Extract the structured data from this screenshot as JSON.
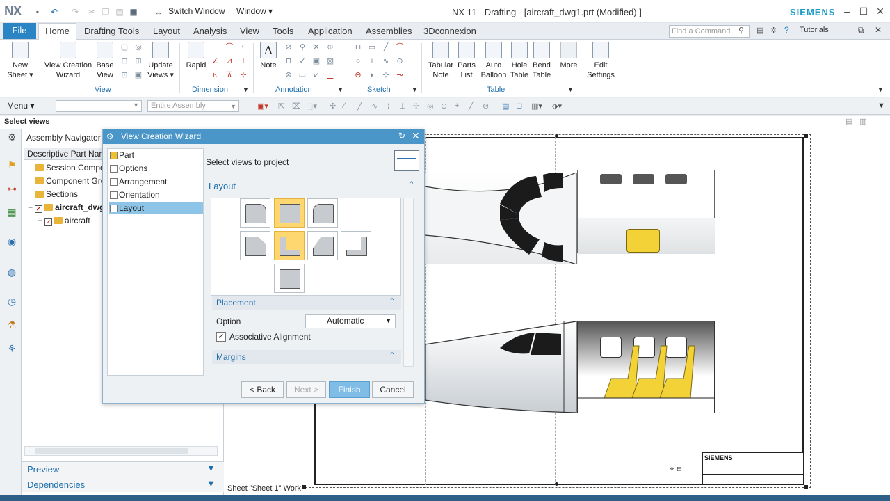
{
  "title_bar": {
    "logo": "NX",
    "switch_window": "Switch Window",
    "window_menu": "Window ▾",
    "title": "NX 11 - Drafting - [aircraft_dwg1.prt (Modified) ]",
    "brand": "SIEMENS"
  },
  "menu_tabs": [
    "File",
    "Home",
    "Drafting Tools",
    "Layout",
    "Analysis",
    "View",
    "Tools",
    "Application",
    "Assemblies",
    "3Dconnexion"
  ],
  "find_command_placeholder": "Find a Command",
  "tutorials": "Tutorials",
  "ribbon": {
    "buttons": [
      {
        "label": "New\nSheet ▾"
      },
      {
        "label": "View Creation\nWizard"
      },
      {
        "label": "Base\nView"
      },
      {
        "label": "Update\nViews ▾"
      },
      {
        "label": "Rapid"
      },
      {
        "label": "Note"
      },
      {
        "label": "Tabular\nNote"
      },
      {
        "label": "Parts\nList"
      },
      {
        "label": "Auto\nBalloon"
      },
      {
        "label": "Hole\nTable"
      },
      {
        "label": "Bend\nTable"
      },
      {
        "label": "More"
      },
      {
        "label": "Edit\nSettings"
      }
    ],
    "groups": [
      "View",
      "Dimension",
      "Annotation",
      "Sketch",
      "Table"
    ]
  },
  "toolbar": {
    "menu": "Menu ▾",
    "assembly_filter": "Entire Assembly"
  },
  "cue": "Select views",
  "navigator": {
    "title": "Assembly Navigator",
    "column_header": "Descriptive Part Nar",
    "rows": [
      {
        "label": "Session Compo"
      },
      {
        "label": "Component Gro"
      },
      {
        "label": "Sections"
      },
      {
        "label": "aircraft_dwg"
      },
      {
        "label": "aircraft"
      }
    ],
    "preview": "Preview",
    "dependencies": "Dependencies"
  },
  "sheet_label": "Sheet \"Sheet 1\" Work",
  "title_block_brand": "SIEMENS",
  "dialog": {
    "title": "View Creation Wizard",
    "nav_items": [
      "Part",
      "Options",
      "Arrangement",
      "Orientation",
      "Layout"
    ],
    "selected_nav": "Layout",
    "instruction": "Select views to project",
    "layout_section": "Layout",
    "placement_section": "Placement",
    "option_label": "Option",
    "option_value": "Automatic",
    "associative_alignment_label": "Associative Alignment",
    "associative_alignment_checked": true,
    "margins_section": "Margins",
    "buttons": {
      "back": "< Back",
      "next": "Next >",
      "finish": "Finish",
      "cancel": "Cancel"
    }
  }
}
